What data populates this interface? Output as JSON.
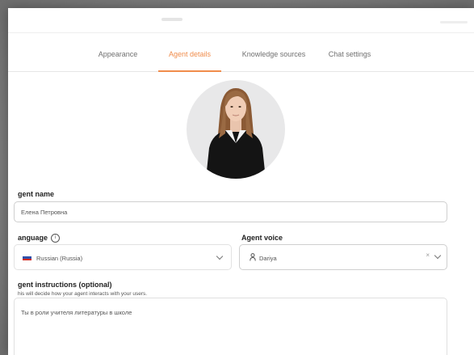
{
  "tabs": [
    {
      "label": "Appearance",
      "active": false
    },
    {
      "label": "Agent details",
      "active": true
    },
    {
      "label": "Knowledge sources",
      "active": false
    },
    {
      "label": "Chat settings",
      "active": false
    }
  ],
  "colors": {
    "accent": "#f08c4b"
  },
  "agent_name": {
    "label": "gent name",
    "value": "Елена Петровна"
  },
  "language": {
    "label": "anguage",
    "value": "Russian (Russia)",
    "icon": "info-icon"
  },
  "voice": {
    "label": "Agent voice",
    "value": "Dariya",
    "icon": "person-icon",
    "clear": "×"
  },
  "instructions": {
    "label": "gent instructions (optional)",
    "sublabel": "his will decide how your agent interacts with your users.",
    "value": "Ты в роли учителя литературы в школе"
  }
}
